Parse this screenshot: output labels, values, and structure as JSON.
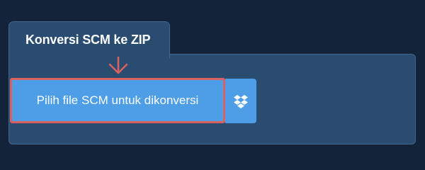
{
  "converter": {
    "tab_title": "Konversi SCM ke ZIP",
    "upload_button_label": "Pilih file SCM untuk dikonversi",
    "dropbox_icon": "dropbox-icon",
    "highlight_arrow_icon": "down-arrow-icon"
  },
  "colors": {
    "background": "#13243a",
    "panel": "#2a4c71",
    "button": "#4d9ee6",
    "highlight": "#d9615f",
    "text": "#ffffff"
  }
}
